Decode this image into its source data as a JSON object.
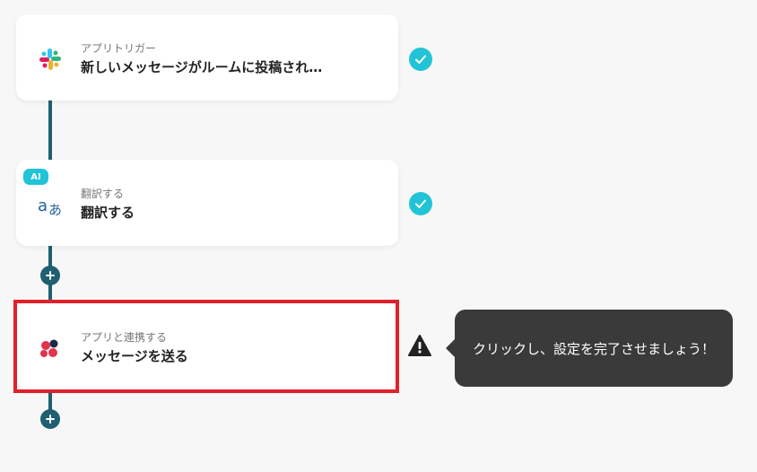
{
  "flow": {
    "steps": [
      {
        "subtitle": "アプリトリガー",
        "title": "新しいメッセージがルームに投稿され…",
        "icon": "slack-icon",
        "status": "completed"
      },
      {
        "badge": "AI",
        "subtitle": "翻訳する",
        "title": "翻訳する",
        "icon": "translate-icon",
        "status": "completed"
      },
      {
        "subtitle": "アプリと連携する",
        "title": "メッセージを送る",
        "icon": "chatwork-icon",
        "status": "warning"
      }
    ]
  },
  "tooltip": {
    "text": "クリックし、設定を完了させましょう！"
  },
  "colors": {
    "connector": "#1f5f6f",
    "check": "#22c3d6",
    "highlight": "#e0202a",
    "tooltip_bg": "#3a3a3a"
  }
}
